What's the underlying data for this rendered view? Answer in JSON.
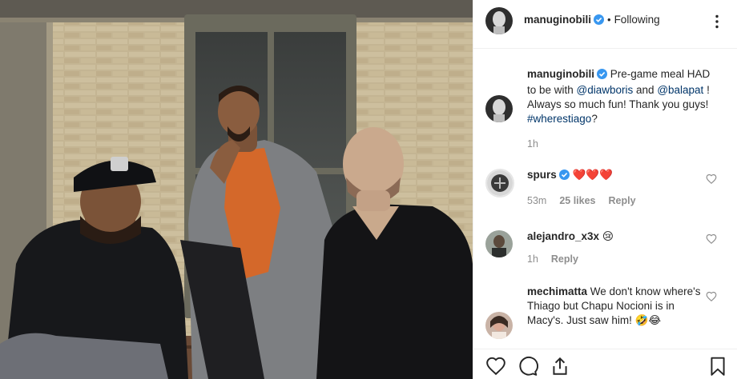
{
  "post": {
    "author": "manuginobili",
    "following_label": "Following",
    "separator": "•"
  },
  "caption": {
    "author": "manuginobili",
    "text_1": " Pre-game meal HAD to be with ",
    "mention_1": "@diawboris",
    "text_2": " and ",
    "mention_2": "@balapat",
    "text_3": " ! Always so much fun! Thank you guys! ",
    "hashtag": "#wherestiago",
    "text_4": "?",
    "time": "1h"
  },
  "comments": [
    {
      "user": "spurs",
      "text": " ❤️❤️❤️",
      "time": "53m",
      "likes": "25 likes",
      "reply": "Reply",
      "verified": true
    },
    {
      "user": "alejandro_x3x",
      "text": " 😢",
      "time": "1h",
      "reply": "Reply",
      "verified": false
    },
    {
      "user": "mechimatta",
      "text": " We don't know where's Thiago but Chapu Nocioni is in Macy's. Just saw him! 🤣😂",
      "verified": false
    }
  ],
  "colors": {
    "verified": "#3897f0",
    "link": "#003569",
    "muted": "#8e8e8e",
    "heart": "#ed4956"
  },
  "icons": [
    "verified-badge-icon",
    "more-options-icon",
    "heart-icon",
    "comment-icon",
    "share-icon",
    "bookmark-icon"
  ]
}
